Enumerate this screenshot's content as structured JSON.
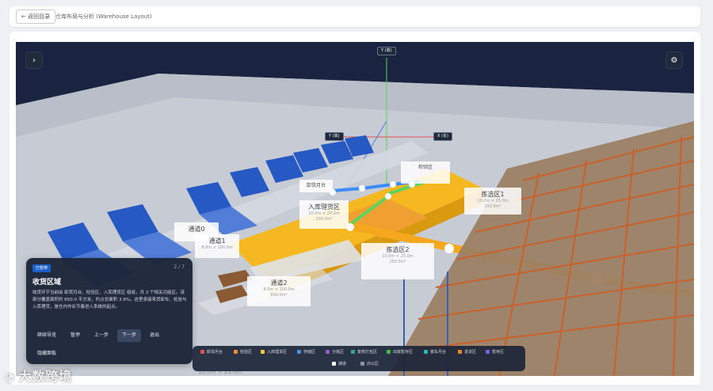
{
  "header": {
    "back_label": "← 返回目录",
    "page_title": "仓库布局与分析 (Warehouse Layout)"
  },
  "scene": {
    "axis_top": "Y (高)",
    "axis_y": "Y (高)",
    "axis_x": "X (长)",
    "zones": [
      {
        "title": "通道0",
        "sub": "",
        "area": ""
      },
      {
        "title": "通道1",
        "sub": "8.0m × 100.0m",
        "area": "800.0m²"
      },
      {
        "title": "通道2",
        "sub": "8.0m × 100.0m",
        "area": "800.0m²"
      },
      {
        "title": "卸货月台",
        "sub": "",
        "area": ""
      },
      {
        "title": "检验区",
        "sub": "",
        "area": ""
      },
      {
        "title": "入库理货区",
        "sub": "10.0m × 20.0m",
        "area": "200.0m²"
      },
      {
        "title": "拣选区1",
        "sub": "10.0m × 25.0m",
        "area": "250.0m²"
      },
      {
        "title": "拣选区2",
        "sub": "10.0m × 25.0m",
        "area": "250.0m²"
      }
    ],
    "floor_text": "10.0m × 25.0m"
  },
  "guide": {
    "status": "已暂停",
    "step": "2 / 7",
    "title": "收货区域",
    "description": "收货环节当前由 卸货月台、检验区、入库理货区 组成，共 3 个相关功能区。该部分覆盖面积约 650.0 平方米，约占总面积 3.9%。这里承接来货卸车、检验与入库理货，是仓内作业节奏进入系统的起点。",
    "buttons": [
      "继续导览",
      "暂停",
      "上一步",
      "下一步",
      "退出"
    ],
    "hide_label": "隐藏面板"
  },
  "legend": [
    {
      "label": "卸货月台",
      "color": "#e05252"
    },
    {
      "label": "检验区",
      "color": "#f08c2e"
    },
    {
      "label": "入库理货区",
      "color": "#f5c542"
    },
    {
      "label": "存储区",
      "color": "#4a8fd9"
    },
    {
      "label": "分拣区",
      "color": "#9b59d0"
    },
    {
      "label": "复核打包区",
      "color": "#2ea58f"
    },
    {
      "label": "出库暂存区",
      "color": "#46b84a"
    },
    {
      "label": "装车月台",
      "color": "#2bb6b0"
    },
    {
      "label": "退货区",
      "color": "#e8842a"
    },
    {
      "label": "暂存区",
      "color": "#7a5fe0"
    },
    {
      "label": "通道",
      "color": "#ffffff"
    },
    {
      "label": "办公区",
      "color": "#8a94a6"
    }
  ],
  "watermark": "大数跨境",
  "colors": {
    "viewport_bg": "#1a2440",
    "accent_blue": "#1d5fc9",
    "zone_yellow": "#f5b820",
    "rack_orange": "#c8612b"
  }
}
